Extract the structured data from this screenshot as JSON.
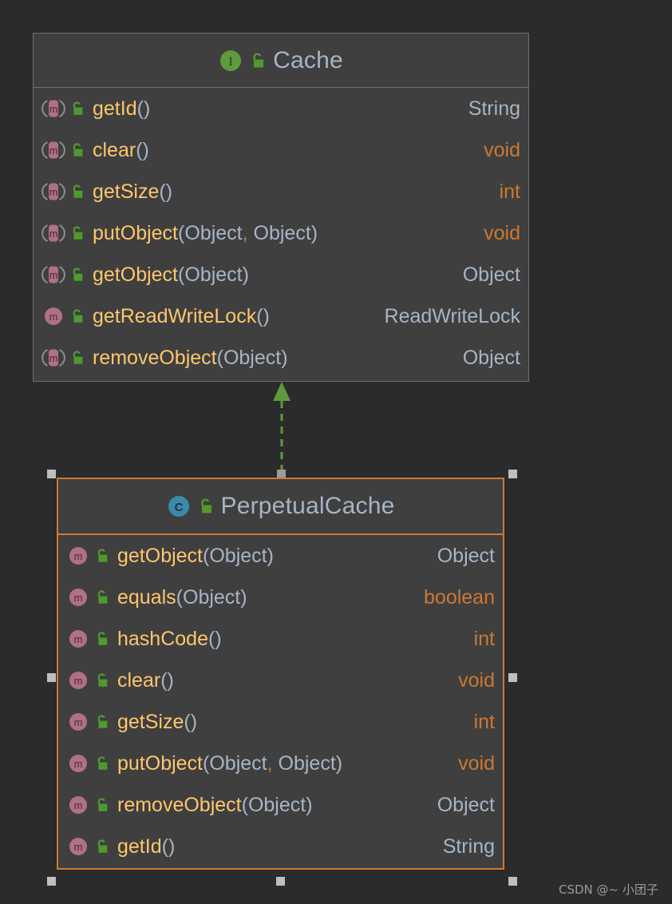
{
  "canvas": {
    "background": "#2b2b2b",
    "box_fill": "#3f3f3f",
    "box_border": "#6e6e6e",
    "selected_border": "#cc7832",
    "relation_color": "#5d9b3e",
    "handle_color": "#bfbfbf"
  },
  "diagram": {
    "type": "uml-class-diagram",
    "relationship": {
      "name": "realization",
      "style": "dashed-line-with-hollow-triangle",
      "from": "PerpetualCache",
      "to": "Cache",
      "color": "#5d9b3e"
    }
  },
  "classes": [
    {
      "id": "cache",
      "name": "Cache",
      "kind": "interface",
      "kind_icon": "interface-icon",
      "visibility": "public",
      "visibility_icon": "unlock-icon",
      "selected": false,
      "members": [
        {
          "icon": "abstract-method-icon",
          "visibility_icon": "unlock-icon",
          "name": "getId",
          "args": [],
          "return": "String",
          "return_kind": "ref"
        },
        {
          "icon": "abstract-method-icon",
          "visibility_icon": "unlock-icon",
          "name": "clear",
          "args": [],
          "return": "void",
          "return_kind": "prim"
        },
        {
          "icon": "abstract-method-icon",
          "visibility_icon": "unlock-icon",
          "name": "getSize",
          "args": [],
          "return": "int",
          "return_kind": "prim"
        },
        {
          "icon": "abstract-method-icon",
          "visibility_icon": "unlock-icon",
          "name": "putObject",
          "args": [
            "Object",
            "Object"
          ],
          "return": "void",
          "return_kind": "prim"
        },
        {
          "icon": "abstract-method-icon",
          "visibility_icon": "unlock-icon",
          "name": "getObject",
          "args": [
            "Object"
          ],
          "return": "Object",
          "return_kind": "ref"
        },
        {
          "icon": "method-icon",
          "visibility_icon": "unlock-icon",
          "name": "getReadWriteLock",
          "args": [],
          "return": "ReadWriteLock",
          "return_kind": "ref"
        },
        {
          "icon": "abstract-method-icon",
          "visibility_icon": "unlock-icon",
          "name": "removeObject",
          "args": [
            "Object"
          ],
          "return": "Object",
          "return_kind": "ref"
        }
      ]
    },
    {
      "id": "perpetualcache",
      "name": "PerpetualCache",
      "kind": "class",
      "kind_icon": "class-icon",
      "visibility": "public",
      "visibility_icon": "unlock-icon",
      "selected": true,
      "members": [
        {
          "icon": "method-icon",
          "visibility_icon": "unlock-icon",
          "name": "getObject",
          "args": [
            "Object"
          ],
          "return": "Object",
          "return_kind": "ref"
        },
        {
          "icon": "method-icon",
          "visibility_icon": "unlock-icon",
          "name": "equals",
          "args": [
            "Object"
          ],
          "return": "boolean",
          "return_kind": "prim"
        },
        {
          "icon": "method-icon",
          "visibility_icon": "unlock-icon",
          "name": "hashCode",
          "args": [],
          "return": "int",
          "return_kind": "prim"
        },
        {
          "icon": "method-icon",
          "visibility_icon": "unlock-icon",
          "name": "clear",
          "args": [],
          "return": "void",
          "return_kind": "prim"
        },
        {
          "icon": "method-icon",
          "visibility_icon": "unlock-icon",
          "name": "getSize",
          "args": [],
          "return": "int",
          "return_kind": "prim"
        },
        {
          "icon": "method-icon",
          "visibility_icon": "unlock-icon",
          "name": "putObject",
          "args": [
            "Object",
            "Object"
          ],
          "return": "void",
          "return_kind": "prim"
        },
        {
          "icon": "method-icon",
          "visibility_icon": "unlock-icon",
          "name": "removeObject",
          "args": [
            "Object"
          ],
          "return": "Object",
          "return_kind": "ref"
        },
        {
          "icon": "method-icon",
          "visibility_icon": "unlock-icon",
          "name": "getId",
          "args": [],
          "return": "String",
          "return_kind": "ref"
        }
      ]
    }
  ],
  "watermark": {
    "text": "CSDN @~ 小团子"
  }
}
